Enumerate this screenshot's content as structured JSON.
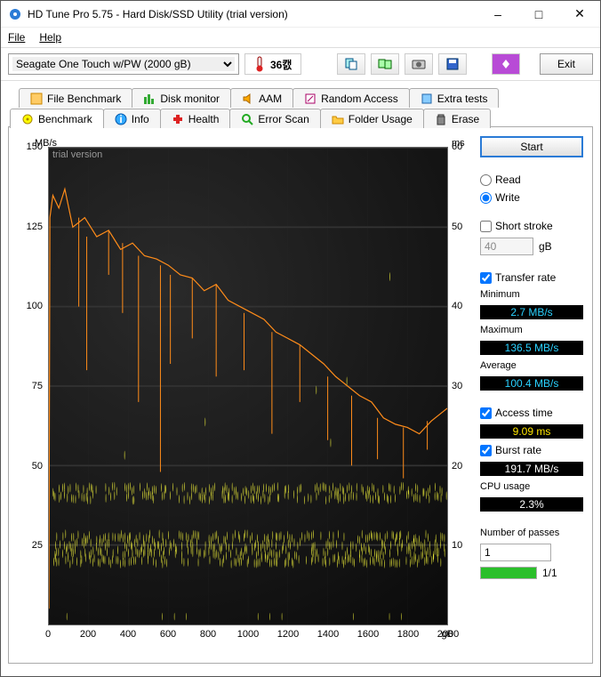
{
  "window": {
    "title": "HD Tune Pro 5.75 - Hard Disk/SSD Utility (trial version)"
  },
  "menu": {
    "file": "File",
    "help": "Help"
  },
  "toolbar": {
    "drive": "Seagate One Touch w/PW (2000 gB)",
    "temp": "36캜",
    "exit": "Exit"
  },
  "tabs_top": {
    "fb": "File Benchmark",
    "dm": "Disk monitor",
    "aam": "AAM",
    "ra": "Random Access",
    "et": "Extra tests"
  },
  "tabs_bottom": {
    "bm": "Benchmark",
    "info": "Info",
    "health": "Health",
    "es": "Error Scan",
    "fu": "Folder Usage",
    "er": "Erase"
  },
  "side": {
    "start": "Start",
    "read": "Read",
    "write": "Write",
    "short": "Short stroke",
    "short_val": "40",
    "short_unit": "gB",
    "tr": "Transfer rate",
    "min": "Minimum",
    "min_v": "2.7 MB/s",
    "max": "Maximum",
    "max_v": "136.5 MB/s",
    "avg": "Average",
    "avg_v": "100.4 MB/s",
    "at": "Access time",
    "at_v": "9.09 ms",
    "br": "Burst rate",
    "br_v": "191.7 MB/s",
    "cpu": "CPU usage",
    "cpu_v": "2.3%",
    "np": "Number of passes",
    "np_v": "1",
    "pass": "1/1"
  },
  "chart_data": {
    "type": "line",
    "watermark": "trial version",
    "y_left": {
      "unit": "MB/s",
      "ticks": [
        25,
        50,
        75,
        100,
        125,
        150
      ],
      "range": [
        0,
        150
      ]
    },
    "y_right": {
      "unit": "ms",
      "ticks": [
        10,
        20,
        30,
        40,
        50,
        60
      ],
      "range": [
        0,
        60
      ]
    },
    "x": {
      "ticks": [
        0,
        200,
        400,
        600,
        800,
        1000,
        1200,
        1400,
        1600,
        1800,
        2000
      ],
      "unit": "gB",
      "range": [
        0,
        2000
      ]
    },
    "series": [
      {
        "name": "Transfer rate (MB/s)",
        "axis": "left",
        "color": "#ff8c1a",
        "values": [
          [
            0,
            5
          ],
          [
            5,
            128
          ],
          [
            20,
            135
          ],
          [
            50,
            131
          ],
          [
            80,
            137
          ],
          [
            120,
            125
          ],
          [
            180,
            128
          ],
          [
            240,
            122
          ],
          [
            300,
            124
          ],
          [
            360,
            118
          ],
          [
            420,
            120
          ],
          [
            480,
            116
          ],
          [
            540,
            115
          ],
          [
            600,
            113
          ],
          [
            660,
            110
          ],
          [
            720,
            109
          ],
          [
            780,
            105
          ],
          [
            840,
            107
          ],
          [
            900,
            102
          ],
          [
            960,
            100
          ],
          [
            1020,
            98
          ],
          [
            1080,
            96
          ],
          [
            1140,
            92
          ],
          [
            1200,
            90
          ],
          [
            1260,
            88
          ],
          [
            1320,
            85
          ],
          [
            1380,
            82
          ],
          [
            1440,
            78
          ],
          [
            1500,
            75
          ],
          [
            1560,
            72
          ],
          [
            1620,
            70
          ],
          [
            1680,
            65
          ],
          [
            1740,
            63
          ],
          [
            1800,
            62
          ],
          [
            1860,
            60
          ],
          [
            1920,
            64
          ],
          [
            1980,
            67
          ],
          [
            2000,
            68
          ]
        ],
        "jitter_low": [
          [
            150,
            100
          ],
          [
            190,
            80
          ],
          [
            300,
            110
          ],
          [
            370,
            98
          ],
          [
            450,
            70
          ],
          [
            560,
            48
          ],
          [
            610,
            82
          ],
          [
            720,
            90
          ],
          [
            840,
            78
          ],
          [
            980,
            80
          ],
          [
            1120,
            60
          ],
          [
            1260,
            70
          ],
          [
            1400,
            58
          ],
          [
            1520,
            50
          ],
          [
            1650,
            52
          ],
          [
            1780,
            46
          ],
          [
            1900,
            55
          ]
        ]
      },
      {
        "name": "Access time (ms)",
        "axis": "right",
        "color": "#f5f53a",
        "scatter": true,
        "bands_ms": [
          8,
          9,
          10,
          11,
          16,
          17
        ]
      }
    ]
  }
}
